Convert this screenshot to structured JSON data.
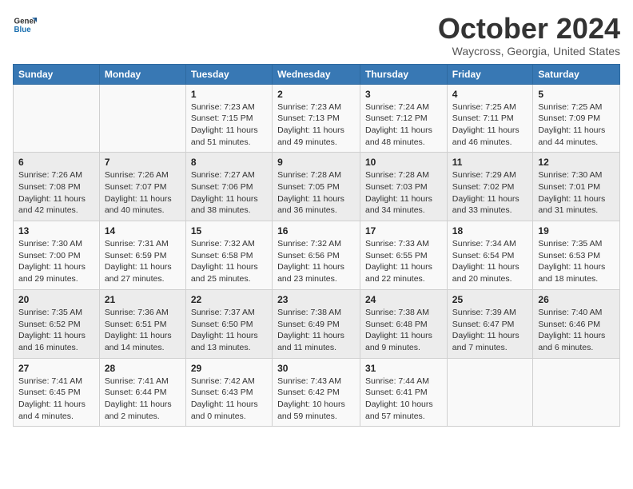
{
  "header": {
    "logo_line1": "General",
    "logo_line2": "Blue",
    "month": "October 2024",
    "location": "Waycross, Georgia, United States"
  },
  "weekdays": [
    "Sunday",
    "Monday",
    "Tuesday",
    "Wednesday",
    "Thursday",
    "Friday",
    "Saturday"
  ],
  "weeks": [
    [
      {
        "day": "",
        "info": ""
      },
      {
        "day": "",
        "info": ""
      },
      {
        "day": "1",
        "info": "Sunrise: 7:23 AM\nSunset: 7:15 PM\nDaylight: 11 hours and 51 minutes."
      },
      {
        "day": "2",
        "info": "Sunrise: 7:23 AM\nSunset: 7:13 PM\nDaylight: 11 hours and 49 minutes."
      },
      {
        "day": "3",
        "info": "Sunrise: 7:24 AM\nSunset: 7:12 PM\nDaylight: 11 hours and 48 minutes."
      },
      {
        "day": "4",
        "info": "Sunrise: 7:25 AM\nSunset: 7:11 PM\nDaylight: 11 hours and 46 minutes."
      },
      {
        "day": "5",
        "info": "Sunrise: 7:25 AM\nSunset: 7:09 PM\nDaylight: 11 hours and 44 minutes."
      }
    ],
    [
      {
        "day": "6",
        "info": "Sunrise: 7:26 AM\nSunset: 7:08 PM\nDaylight: 11 hours and 42 minutes."
      },
      {
        "day": "7",
        "info": "Sunrise: 7:26 AM\nSunset: 7:07 PM\nDaylight: 11 hours and 40 minutes."
      },
      {
        "day": "8",
        "info": "Sunrise: 7:27 AM\nSunset: 7:06 PM\nDaylight: 11 hours and 38 minutes."
      },
      {
        "day": "9",
        "info": "Sunrise: 7:28 AM\nSunset: 7:05 PM\nDaylight: 11 hours and 36 minutes."
      },
      {
        "day": "10",
        "info": "Sunrise: 7:28 AM\nSunset: 7:03 PM\nDaylight: 11 hours and 34 minutes."
      },
      {
        "day": "11",
        "info": "Sunrise: 7:29 AM\nSunset: 7:02 PM\nDaylight: 11 hours and 33 minutes."
      },
      {
        "day": "12",
        "info": "Sunrise: 7:30 AM\nSunset: 7:01 PM\nDaylight: 11 hours and 31 minutes."
      }
    ],
    [
      {
        "day": "13",
        "info": "Sunrise: 7:30 AM\nSunset: 7:00 PM\nDaylight: 11 hours and 29 minutes."
      },
      {
        "day": "14",
        "info": "Sunrise: 7:31 AM\nSunset: 6:59 PM\nDaylight: 11 hours and 27 minutes."
      },
      {
        "day": "15",
        "info": "Sunrise: 7:32 AM\nSunset: 6:58 PM\nDaylight: 11 hours and 25 minutes."
      },
      {
        "day": "16",
        "info": "Sunrise: 7:32 AM\nSunset: 6:56 PM\nDaylight: 11 hours and 23 minutes."
      },
      {
        "day": "17",
        "info": "Sunrise: 7:33 AM\nSunset: 6:55 PM\nDaylight: 11 hours and 22 minutes."
      },
      {
        "day": "18",
        "info": "Sunrise: 7:34 AM\nSunset: 6:54 PM\nDaylight: 11 hours and 20 minutes."
      },
      {
        "day": "19",
        "info": "Sunrise: 7:35 AM\nSunset: 6:53 PM\nDaylight: 11 hours and 18 minutes."
      }
    ],
    [
      {
        "day": "20",
        "info": "Sunrise: 7:35 AM\nSunset: 6:52 PM\nDaylight: 11 hours and 16 minutes."
      },
      {
        "day": "21",
        "info": "Sunrise: 7:36 AM\nSunset: 6:51 PM\nDaylight: 11 hours and 14 minutes."
      },
      {
        "day": "22",
        "info": "Sunrise: 7:37 AM\nSunset: 6:50 PM\nDaylight: 11 hours and 13 minutes."
      },
      {
        "day": "23",
        "info": "Sunrise: 7:38 AM\nSunset: 6:49 PM\nDaylight: 11 hours and 11 minutes."
      },
      {
        "day": "24",
        "info": "Sunrise: 7:38 AM\nSunset: 6:48 PM\nDaylight: 11 hours and 9 minutes."
      },
      {
        "day": "25",
        "info": "Sunrise: 7:39 AM\nSunset: 6:47 PM\nDaylight: 11 hours and 7 minutes."
      },
      {
        "day": "26",
        "info": "Sunrise: 7:40 AM\nSunset: 6:46 PM\nDaylight: 11 hours and 6 minutes."
      }
    ],
    [
      {
        "day": "27",
        "info": "Sunrise: 7:41 AM\nSunset: 6:45 PM\nDaylight: 11 hours and 4 minutes."
      },
      {
        "day": "28",
        "info": "Sunrise: 7:41 AM\nSunset: 6:44 PM\nDaylight: 11 hours and 2 minutes."
      },
      {
        "day": "29",
        "info": "Sunrise: 7:42 AM\nSunset: 6:43 PM\nDaylight: 11 hours and 0 minutes."
      },
      {
        "day": "30",
        "info": "Sunrise: 7:43 AM\nSunset: 6:42 PM\nDaylight: 10 hours and 59 minutes."
      },
      {
        "day": "31",
        "info": "Sunrise: 7:44 AM\nSunset: 6:41 PM\nDaylight: 10 hours and 57 minutes."
      },
      {
        "day": "",
        "info": ""
      },
      {
        "day": "",
        "info": ""
      }
    ]
  ]
}
